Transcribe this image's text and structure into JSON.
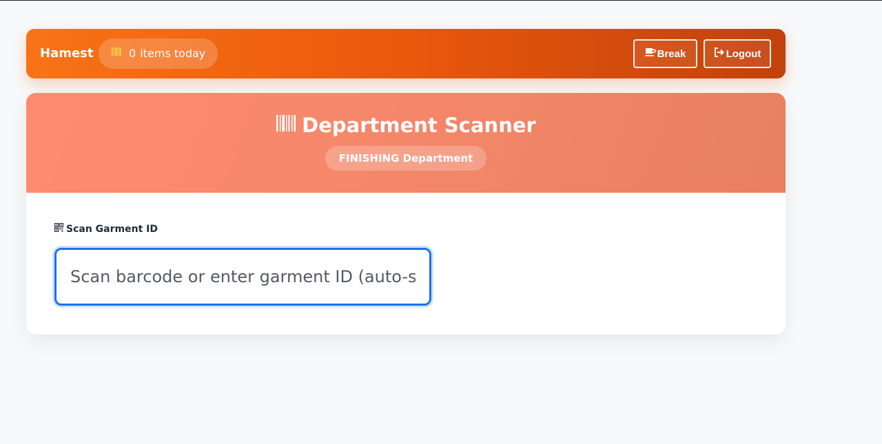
{
  "navbar": {
    "user_name": "Hamest",
    "items_count": "0",
    "items_suffix": "items today",
    "break_label": "Break",
    "logout_label": "Logout"
  },
  "scanner": {
    "title": "Department Scanner",
    "department_badge": "FINISHING Department",
    "field_label": "Scan Garment ID",
    "input_placeholder": "Scan barcode or enter garment ID (auto-scan)",
    "input_value": ""
  },
  "colors": {
    "navbar_gradient_start": "#f97316",
    "navbar_gradient_end": "#c2410c",
    "header_gradient_start": "#ff8a70",
    "header_gradient_end": "#e8805f",
    "input_focus_border": "#1a73e8",
    "barcode_icon_accent": "#fde047"
  },
  "icons": {
    "count_pill_icon": "barcode-icon",
    "break_icon": "coffee-icon",
    "logout_icon": "sign-out-icon",
    "title_icon": "barcode-icon",
    "field_icon": "qrcode-icon"
  }
}
